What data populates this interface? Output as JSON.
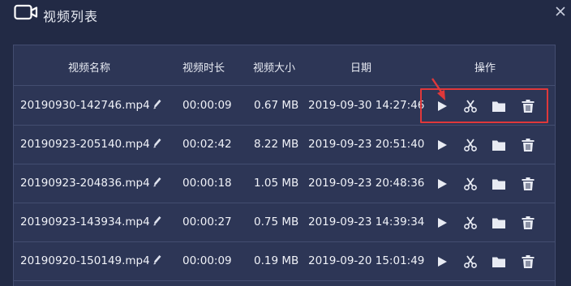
{
  "window": {
    "title": "视频列表",
    "title_icon": "video-camera-icon",
    "close_icon": "close-icon"
  },
  "table": {
    "headers": {
      "name": "视频名称",
      "duration": "视频时长",
      "size": "视频大小",
      "date": "日期",
      "actions": "操作"
    },
    "rows": [
      {
        "name": "20190930-142746.mp4",
        "duration": "00:00:09",
        "size": "0.67 MB",
        "date": "2019-09-30 14:27:46"
      },
      {
        "name": "20190923-205140.mp4",
        "duration": "00:02:42",
        "size": "8.22 MB",
        "date": "2019-09-23 20:51:40"
      },
      {
        "name": "20190923-204836.mp4",
        "duration": "00:00:18",
        "size": "1.05 MB",
        "date": "2019-09-23 20:48:36"
      },
      {
        "name": "20190923-143934.mp4",
        "duration": "00:00:27",
        "size": "0.75 MB",
        "date": "2019-09-23 14:39:34"
      },
      {
        "name": "20190920-150149.mp4",
        "duration": "00:00:09",
        "size": "0.19 MB",
        "date": "2019-09-20 15:01:49"
      }
    ],
    "action_icons": [
      "play-icon",
      "scissors-icon",
      "folder-icon",
      "trash-icon"
    ]
  },
  "colors": {
    "background": "#222a45",
    "table_background": "#2d3656",
    "border": "#434d70",
    "highlight": "#e0383a",
    "text": "#f0f2f8"
  }
}
